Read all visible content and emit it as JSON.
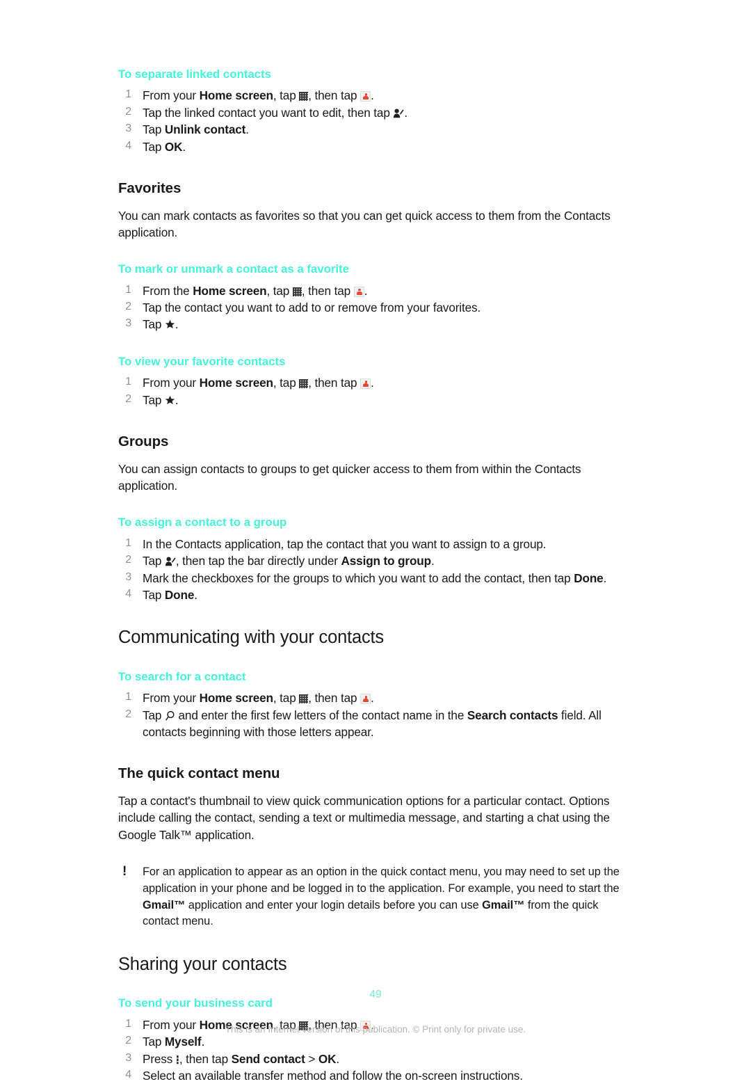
{
  "page": {
    "number": "49",
    "footer_note": "This is an Internet version of this publication. © Print only for private use."
  },
  "colors": {
    "task_heading": "#47f2da",
    "page_number": "#70ecdd",
    "step_number": "#909090",
    "body_text": "#1a1a1a",
    "footer_text": "#b5b5b5"
  },
  "sections": {
    "separate_linked": {
      "task_heading": "To separate linked contacts",
      "steps": {
        "s1_a": "From your ",
        "s1_b": "Home screen",
        "s1_c": ", tap ",
        "s1_d": ", then tap ",
        "s1_e": ".",
        "s2_a": "Tap the linked contact you want to edit, then tap ",
        "s2_b": ".",
        "s3_a": "Tap ",
        "s3_b": "Unlink contact",
        "s3_c": ".",
        "s4_a": "Tap ",
        "s4_b": "OK",
        "s4_c": "."
      }
    },
    "favorites": {
      "heading": "Favorites",
      "intro": "You can mark contacts as favorites so that you can get quick access to them from the Contacts application.",
      "mark_task": {
        "task_heading": "To mark or unmark a contact as a favorite",
        "s1_a": "From the ",
        "s1_b": "Home screen",
        "s1_c": ", tap ",
        "s1_d": ", then tap ",
        "s1_e": ".",
        "s2": "Tap the contact you want to add to or remove from your favorites.",
        "s3_a": "Tap ",
        "s3_b": "."
      },
      "view_task": {
        "task_heading": "To view your favorite contacts",
        "s1_a": "From your ",
        "s1_b": "Home screen",
        "s1_c": ", tap ",
        "s1_d": ", then tap ",
        "s1_e": ".",
        "s2_a": "Tap ",
        "s2_b": "."
      }
    },
    "groups": {
      "heading": "Groups",
      "intro": "You can assign contacts to groups to get quicker access to them from within the Contacts application.",
      "assign_task": {
        "task_heading": "To assign a contact to a group",
        "s1": "In the Contacts application, tap the contact that you want to assign to a group.",
        "s2_a": "Tap ",
        "s2_b": ", then tap the bar directly under ",
        "s2_c": "Assign to group",
        "s2_d": ".",
        "s3_a": "Mark the checkboxes for the groups to which you want to add the contact, then tap ",
        "s3_b": "Done",
        "s3_c": ".",
        "s4_a": "Tap ",
        "s4_b": "Done",
        "s4_c": "."
      }
    },
    "communicating": {
      "heading": "Communicating with your contacts",
      "search_task": {
        "task_heading": "To search for a contact",
        "s1_a": "From your ",
        "s1_b": "Home screen",
        "s1_c": ", tap ",
        "s1_d": ", then tap ",
        "s1_e": ".",
        "s2_a": "Tap ",
        "s2_b": " and enter the first few letters of the contact name in the ",
        "s2_c": "Search contacts",
        "s2_d": " field. All contacts beginning with those letters appear."
      },
      "quick_menu": {
        "heading": "The quick contact menu",
        "body": "Tap a contact's thumbnail to view quick communication options for a particular contact. Options include calling the contact, sending a text or multimedia message, and starting a chat using the Google Talk™ application.",
        "note_icon": "exclamation-mark",
        "note_a": "For an application to appear as an option in the quick contact menu, you may need to set up the application in your phone and be logged in to the application. For example, you need to start the ",
        "note_b": "Gmail™",
        "note_c": " application and enter your login details before you can use ",
        "note_d": "Gmail™",
        "note_e": " from the quick contact menu."
      }
    },
    "sharing": {
      "heading": "Sharing your contacts",
      "business_card_task": {
        "task_heading": "To send your business card",
        "s1_a": "From your ",
        "s1_b": "Home screen",
        "s1_c": ", tap ",
        "s1_d": ", then tap ",
        "s1_e": ".",
        "s2_a": "Tap ",
        "s2_b": "Myself",
        "s2_c": ".",
        "s3_a": "Press ",
        "s3_b": ", then tap ",
        "s3_c": "Send contact",
        "s3_d": " > ",
        "s3_e": "OK",
        "s3_f": ".",
        "s4": "Select an available transfer method and follow the on-screen instructions."
      }
    }
  },
  "icons": {
    "grid": "app-drawer-grid-icon",
    "contacts": "contacts-app-icon",
    "edit_contact": "edit-contact-icon",
    "star": "star-icon",
    "search": "search-magnifier-icon",
    "menu_key": "menu-key-icon"
  }
}
